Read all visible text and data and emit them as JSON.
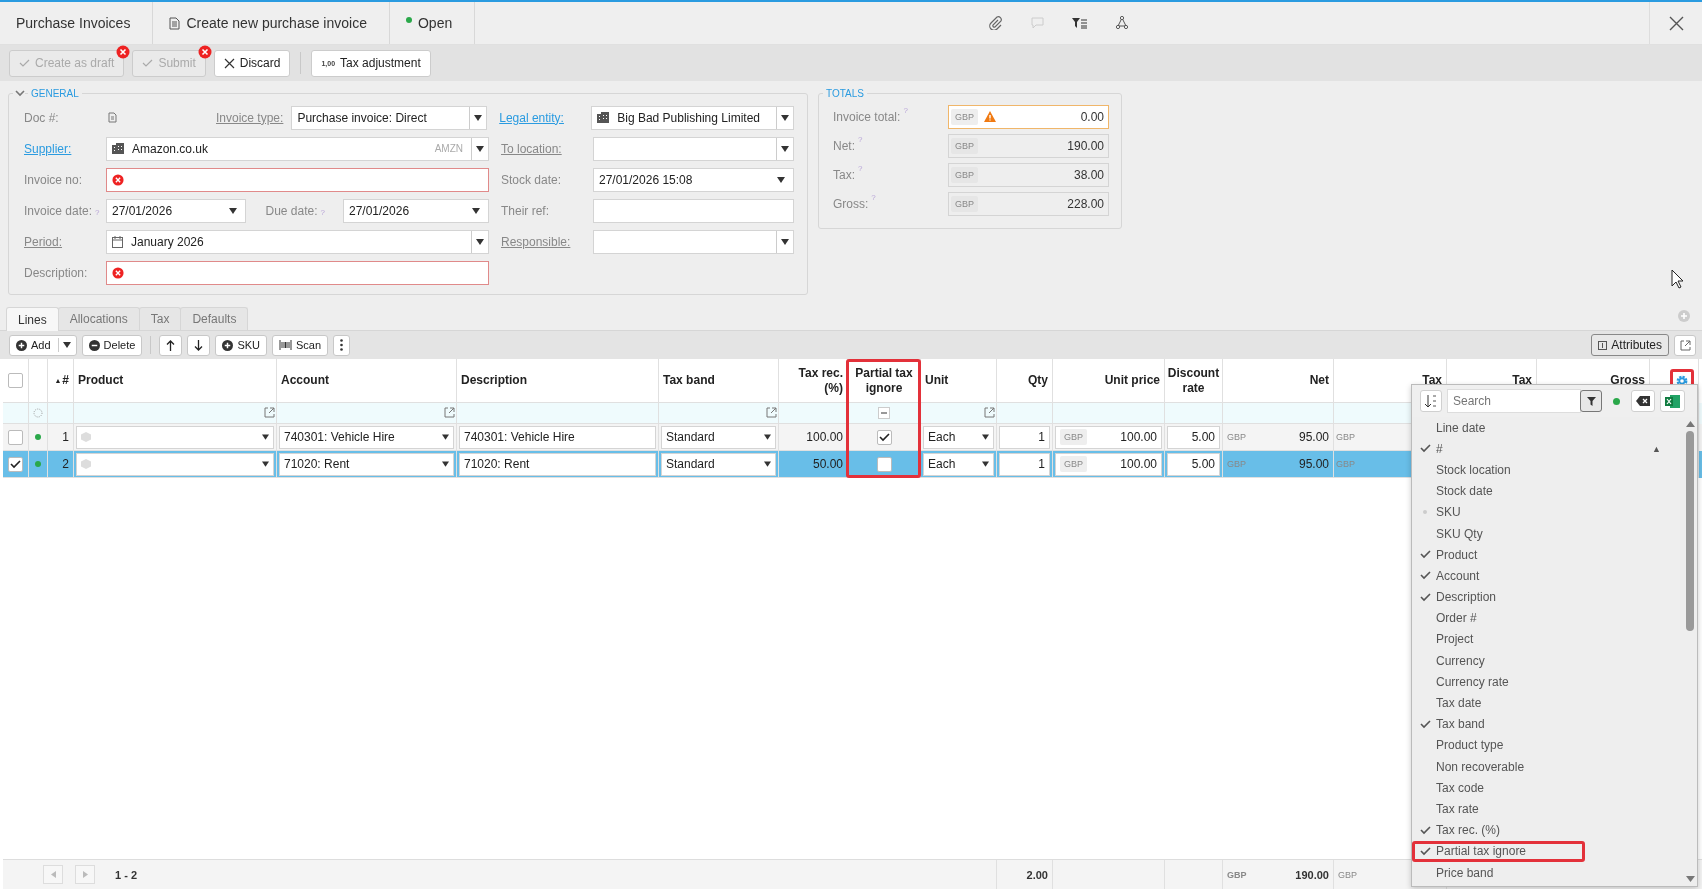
{
  "top_bar": {
    "breadcrumbs": [
      {
        "label": "Purchase Invoices"
      },
      {
        "label": "Create new purchase invoice"
      },
      {
        "label": "Open",
        "color": "#2aa84a"
      }
    ]
  },
  "actions": [
    {
      "label": "Create as draft",
      "disabled": true,
      "error": true
    },
    {
      "label": "Submit",
      "disabled": true,
      "error": true
    },
    {
      "label": "Discard",
      "disabled": false,
      "error": false
    },
    {
      "label": "Tax adjustment",
      "icon_text": "1,00",
      "disabled": false,
      "error": false
    }
  ],
  "general": {
    "title": "GENERAL",
    "rows": [
      {
        "left": [
          {
            "label": "Doc #:",
            "link": false,
            "kind": "doc"
          },
          {
            "label": "Invoice type:",
            "link": true,
            "active": false,
            "kind": "select",
            "value": "Purchase invoice: Direct"
          }
        ],
        "right": {
          "label": "Legal entity:",
          "link": true,
          "active": true,
          "kind": "entity-select",
          "value": "Big Bad Publishing Limited"
        }
      },
      {
        "left": [
          {
            "label": "Supplier:",
            "link": true,
            "active": true,
            "kind": "entity-select",
            "value": "Amazon.co.uk",
            "code": "AMZN"
          }
        ],
        "right": {
          "label": "To location:",
          "link": true,
          "active": false,
          "kind": "select"
        }
      },
      {
        "left": [
          {
            "label": "Invoice no:",
            "link": false,
            "kind": "error"
          }
        ],
        "right": {
          "label": "Stock date:",
          "link": false,
          "kind": "date",
          "value": "27/01/2026 15:08"
        }
      },
      {
        "left": [
          {
            "label": "Invoice date:",
            "link": false,
            "help": "?",
            "kind": "date",
            "value": "27/01/2026"
          },
          {
            "label": "Due date:",
            "link": false,
            "help": "?",
            "kind": "date",
            "value": "27/01/2026"
          }
        ],
        "right": {
          "label": "Their ref:",
          "link": false,
          "kind": "text"
        }
      },
      {
        "left": [
          {
            "label": "Period:",
            "link": true,
            "active": false,
            "kind": "period-select",
            "value": "January 2026"
          }
        ],
        "right": {
          "label": "Responsible:",
          "link": true,
          "active": false,
          "kind": "select"
        }
      },
      {
        "left": [
          {
            "label": "Description:",
            "link": false,
            "kind": "error"
          }
        ]
      }
    ]
  },
  "totals": {
    "title": "TOTALS",
    "rows": [
      {
        "label": "Invoice total:",
        "help": "?",
        "currency": "GBP",
        "value": "0.00",
        "warning": true
      },
      {
        "label": "Net:",
        "help": "?",
        "currency": "GBP",
        "value": "190.00",
        "warning": false
      },
      {
        "label": "Tax:",
        "help": "?",
        "currency": "GBP",
        "value": "38.00",
        "warning": false
      },
      {
        "label": "Gross:",
        "help": "?",
        "currency": "GBP",
        "value": "228.00",
        "warning": false
      }
    ]
  },
  "tabs": [
    {
      "label": "Lines",
      "selected": true
    },
    {
      "label": "Allocations",
      "selected": false
    },
    {
      "label": "Tax",
      "selected": false
    },
    {
      "label": "Defaults",
      "selected": false
    }
  ],
  "grid_toolbar": {
    "buttons": [
      {
        "kind": "add",
        "label": "Add",
        "split": true
      },
      {
        "kind": "delete",
        "label": "Delete"
      },
      {
        "kind": "up"
      },
      {
        "kind": "down"
      },
      {
        "kind": "sku",
        "label": "SKU"
      },
      {
        "kind": "scan",
        "label": "Scan"
      },
      {
        "kind": "more"
      }
    ],
    "attributes": "Attributes"
  },
  "table": {
    "columns": [
      {
        "kind": "select-all",
        "checked": false
      },
      {
        "kind": "status"
      },
      {
        "kind": "text",
        "label": "#",
        "sort_mark": "▲"
      },
      {
        "kind": "text",
        "label": "Product",
        "filter_button": true
      },
      {
        "kind": "text",
        "label": "Account",
        "filter_button": true
      },
      {
        "kind": "text",
        "label": "Description"
      },
      {
        "kind": "text",
        "label": "Tax band",
        "filter_button": true
      },
      {
        "kind": "text",
        "label": "Tax rec. (%)"
      },
      {
        "kind": "text",
        "label": "Partial tax ignore",
        "filter_indeterminate": true,
        "highlighted": true
      },
      {
        "kind": "text",
        "label": "Unit",
        "filter_button": true
      },
      {
        "kind": "text",
        "label": "Qty"
      },
      {
        "kind": "text",
        "label": "Unit price"
      },
      {
        "kind": "text",
        "label": "Discount rate"
      },
      {
        "kind": "text",
        "label": "Net"
      },
      {
        "kind": "text",
        "label": "Tax"
      },
      {
        "kind": "text",
        "label": "Tax"
      },
      {
        "kind": "text",
        "label": "Gross"
      },
      {
        "kind": "settings",
        "highlighted": true
      }
    ],
    "rows": [
      {
        "selected": false,
        "color": "#2aa84a",
        "number": "1",
        "account": "740301: Vehicle Hire",
        "description": "740301: Vehicle Hire",
        "tax_band": "Standard",
        "tax_rec": "100.00",
        "partial_tax_ignore": true,
        "unit": "Each",
        "qty": "1",
        "price_currency": "GBP",
        "unit_price": "100.00",
        "discount": "5.00",
        "net_currency": "GBP",
        "net": "95.00",
        "tax_currency": "GBP"
      },
      {
        "selected": true,
        "color": "#2aa84a",
        "number": "2",
        "account": "71020: Rent",
        "description": "71020: Rent",
        "tax_band": "Standard",
        "tax_rec": "50.00",
        "partial_tax_ignore": false,
        "unit": "Each",
        "qty": "1",
        "price_currency": "GBP",
        "unit_price": "100.00",
        "discount": "5.00",
        "net_currency": "GBP",
        "net": "95.00",
        "tax_currency": "GBP"
      }
    ],
    "footer": {
      "pager": "1 - 2",
      "qty_total": "2.00",
      "net_currency": "GBP",
      "net_total": "190.00",
      "tax_currency": "GBP"
    }
  },
  "column_chooser": {
    "search_placeholder": "Search",
    "items": [
      {
        "label": "Line date",
        "checked": false,
        "indeterminate": false,
        "highlighted": false
      },
      {
        "label": "#",
        "checked": true,
        "indeterminate": false,
        "sort_mark": "▲",
        "highlighted": false
      },
      {
        "label": "Stock location",
        "checked": false,
        "indeterminate": false,
        "highlighted": false
      },
      {
        "label": "Stock date",
        "checked": false,
        "indeterminate": false,
        "highlighted": false
      },
      {
        "label": "SKU",
        "checked": false,
        "indeterminate": true,
        "highlighted": false
      },
      {
        "label": "SKU Qty",
        "checked": false,
        "indeterminate": false,
        "highlighted": false
      },
      {
        "label": "Product",
        "checked": true,
        "indeterminate": false,
        "highlighted": false
      },
      {
        "label": "Account",
        "checked": true,
        "indeterminate": false,
        "highlighted": false
      },
      {
        "label": "Description",
        "checked": true,
        "indeterminate": false,
        "highlighted": false
      },
      {
        "label": "Order #",
        "checked": false,
        "indeterminate": false,
        "highlighted": false
      },
      {
        "label": "Project",
        "checked": false,
        "indeterminate": false,
        "highlighted": false
      },
      {
        "label": "Currency",
        "checked": false,
        "indeterminate": false,
        "highlighted": false
      },
      {
        "label": "Currency rate",
        "checked": false,
        "indeterminate": false,
        "highlighted": false
      },
      {
        "label": "Tax date",
        "checked": false,
        "indeterminate": false,
        "highlighted": false
      },
      {
        "label": "Tax band",
        "checked": true,
        "indeterminate": false,
        "highlighted": false
      },
      {
        "label": "Product type",
        "checked": false,
        "indeterminate": false,
        "highlighted": false
      },
      {
        "label": "Non recoverable",
        "checked": false,
        "indeterminate": false,
        "highlighted": false
      },
      {
        "label": "Tax code",
        "checked": false,
        "indeterminate": false,
        "highlighted": false
      },
      {
        "label": "Tax rate",
        "checked": false,
        "indeterminate": false,
        "highlighted": false
      },
      {
        "label": "Tax rec. (%)",
        "checked": true,
        "indeterminate": false,
        "highlighted": false
      },
      {
        "label": "Partial tax ignore",
        "checked": true,
        "indeterminate": false,
        "highlighted": true
      },
      {
        "label": "Price band",
        "checked": false,
        "indeterminate": false,
        "highlighted": false
      }
    ]
  }
}
